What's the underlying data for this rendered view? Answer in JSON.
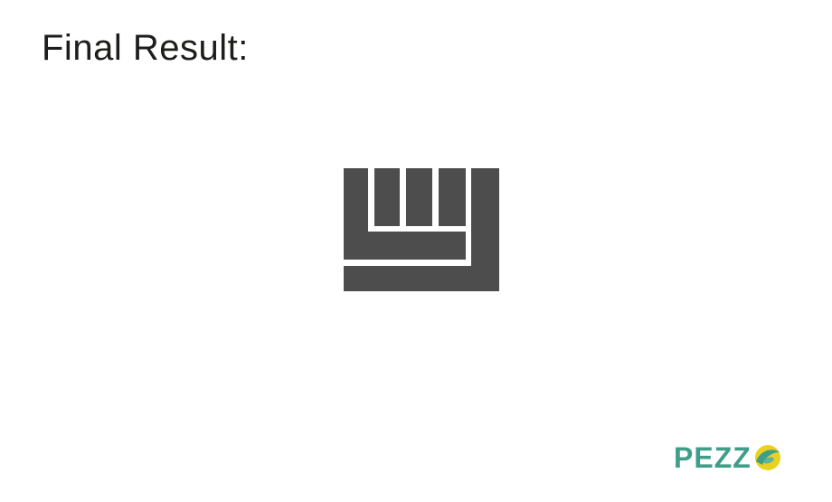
{
  "slide": {
    "title": "Final Result:"
  },
  "figure": {
    "fill_color": "#4d4d4d",
    "background_color": "#ffffff",
    "icon": "comb-bracket-shape"
  },
  "brand": {
    "logo_text": "PEZZ",
    "logo_mark_icon": "o-swoosh-icon",
    "text_color": "#3f9e8a",
    "mark_teal": "#3f9e8a",
    "mark_yellow": "#e9d21f"
  }
}
